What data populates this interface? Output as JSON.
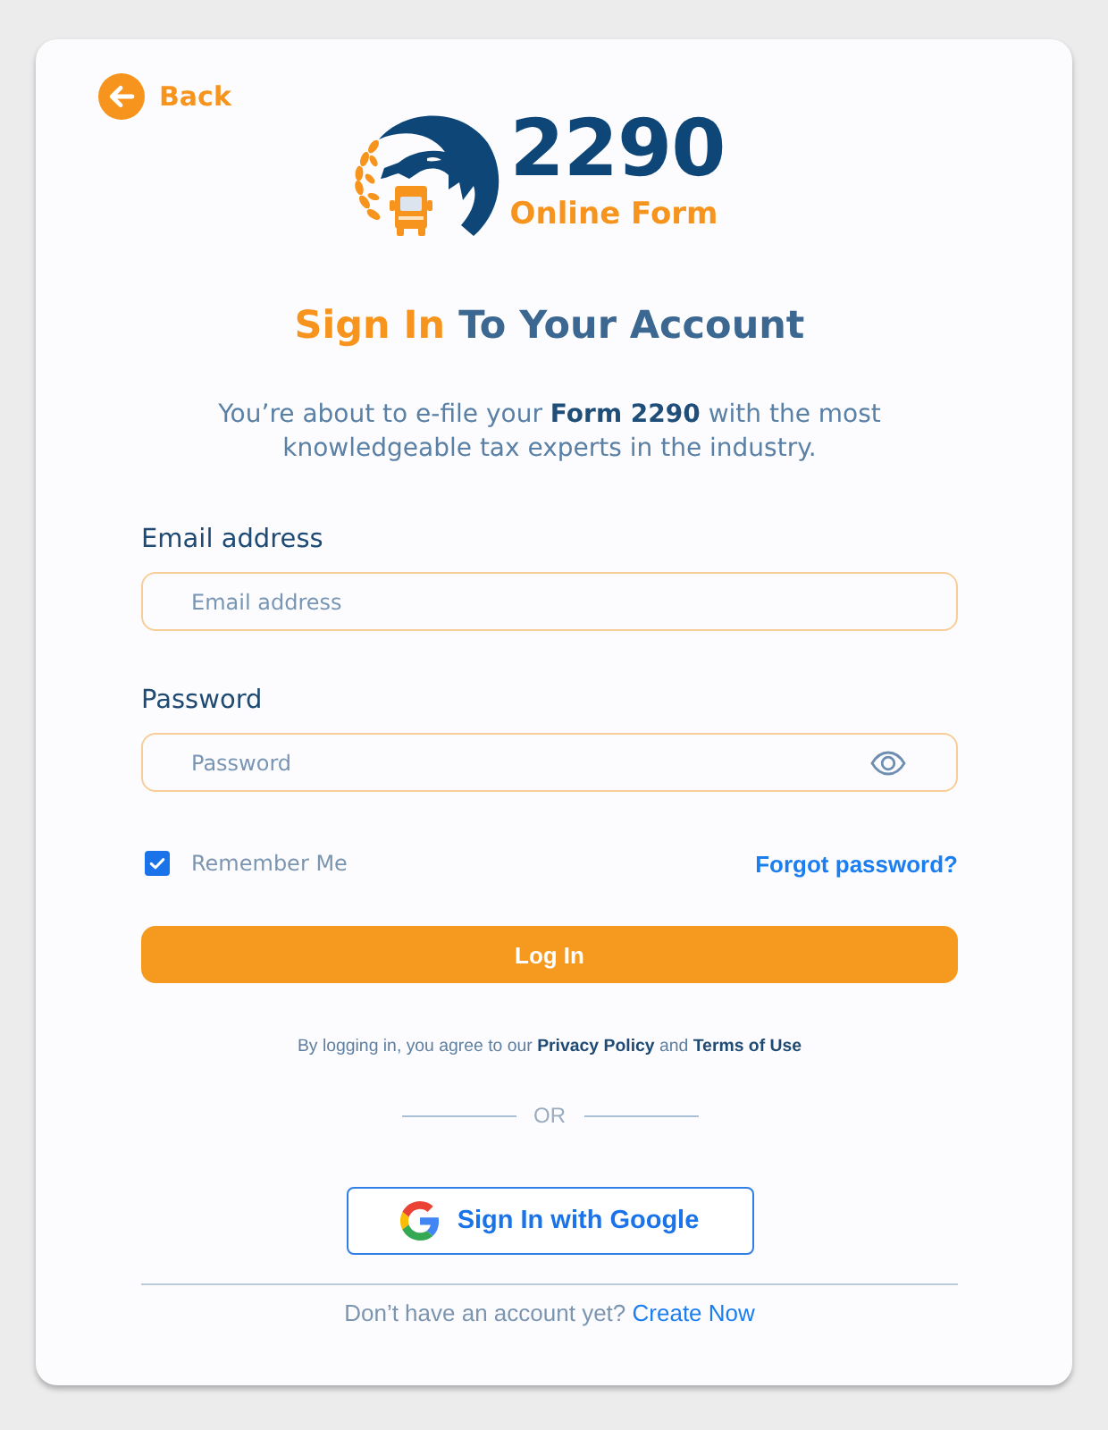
{
  "back_link": {
    "label": "Back"
  },
  "logo": {
    "number": "2290",
    "tagline": "Online Form"
  },
  "heading": {
    "accent": "Sign In",
    "text": "To Your Account"
  },
  "intro": "You’re about to e-file your **Form 2290** with the most knowledgeable tax experts in the industry.",
  "fields": [
    {
      "kind": "email",
      "label": "Email address",
      "placeholder": "Email address"
    },
    {
      "kind": "password",
      "label": "Password",
      "placeholder": "Password"
    }
  ],
  "remember_me": {
    "label": "Remember Me",
    "checked": true
  },
  "forgot_password": {
    "label": "Forgot password?"
  },
  "login_button": {
    "label": "Log In"
  },
  "terms": [
    {
      "kind": "text",
      "text": "By logging in, you agree to our"
    },
    {
      "kind": "link",
      "text": "Privacy Policy"
    },
    {
      "kind": "text",
      "text": "and"
    },
    {
      "kind": "link",
      "text": "Terms of Use"
    }
  ],
  "divider": {
    "label": "OR"
  },
  "google_button": {
    "label": "Sign In with Google"
  },
  "signup": {
    "prompt": "Don’t have an account yet?",
    "link": "Create Now"
  }
}
